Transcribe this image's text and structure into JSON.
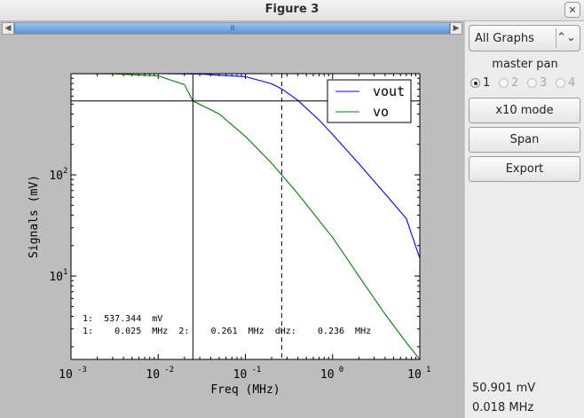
{
  "window": {
    "title": "Figure 3",
    "close_glyph": "✕"
  },
  "scrollbar": {
    "left_glyph": "◀",
    "right_glyph": "▶",
    "grip": "⁞⁞⁞"
  },
  "sidebar": {
    "dropdown_value": "All Graphs",
    "dropdown_glyph": "⌃⌄",
    "master_label": "master pan",
    "radios": [
      {
        "label": "1",
        "selected": true,
        "enabled": true
      },
      {
        "label": "2",
        "selected": false,
        "enabled": false
      },
      {
        "label": "3",
        "selected": false,
        "enabled": false
      },
      {
        "label": "4",
        "selected": false,
        "enabled": false
      }
    ],
    "buttons": {
      "x10": "x10 mode",
      "span": "Span",
      "export": "Export"
    },
    "readout_value": "50.901 mV",
    "readout_freq": "0.018 MHz"
  },
  "chart_data": {
    "type": "line",
    "xlabel": "Freq (MHz)",
    "ylabel": "Signals (mV)",
    "x_scale": "log",
    "y_scale": "log",
    "xlim": [
      0.001,
      10
    ],
    "ylim": [
      1.5,
      1000
    ],
    "x_ticks": [
      {
        "base": "10",
        "exp": "-3"
      },
      {
        "base": "10",
        "exp": "-2"
      },
      {
        "base": "10",
        "exp": "-1"
      },
      {
        "base": "10",
        "exp": "0"
      },
      {
        "base": "10",
        "exp": "1"
      }
    ],
    "y_ticks": [
      {
        "base": "10",
        "exp": "1"
      },
      {
        "base": "10",
        "exp": "2"
      }
    ],
    "legend_position": "top-right",
    "series": [
      {
        "name": "vout",
        "color": "#0000ff",
        "x": [
          0.001,
          0.01,
          0.03,
          0.1,
          0.2,
          0.26,
          0.4,
          0.7,
          1,
          2,
          4,
          7,
          10
        ],
        "y": [
          1000,
          999,
          992,
          934,
          794,
          708,
          545,
          348,
          251,
          129,
          65,
          37,
          15
        ]
      },
      {
        "name": "vo",
        "color": "#008000",
        "x": [
          0.001,
          0.003,
          0.01,
          0.02,
          0.025,
          0.05,
          0.1,
          0.2,
          0.4,
          1,
          2,
          4,
          7,
          10
        ],
        "y": [
          1000,
          995,
          950,
          780,
          537,
          400,
          240,
          130,
          65,
          24,
          10,
          4.2,
          2.2,
          1.5
        ]
      }
    ],
    "cursors": [
      {
        "type": "vertical-solid",
        "x": 0.025
      },
      {
        "type": "vertical-dashed",
        "x": 0.261
      },
      {
        "type": "horizontal-solid",
        "y": 537.344
      }
    ],
    "annotation_lines": [
      "1:  537.344  mV",
      "1:    0.025  MHz  2:    0.261  MHz  dHz:    0.236  MHz"
    ]
  }
}
